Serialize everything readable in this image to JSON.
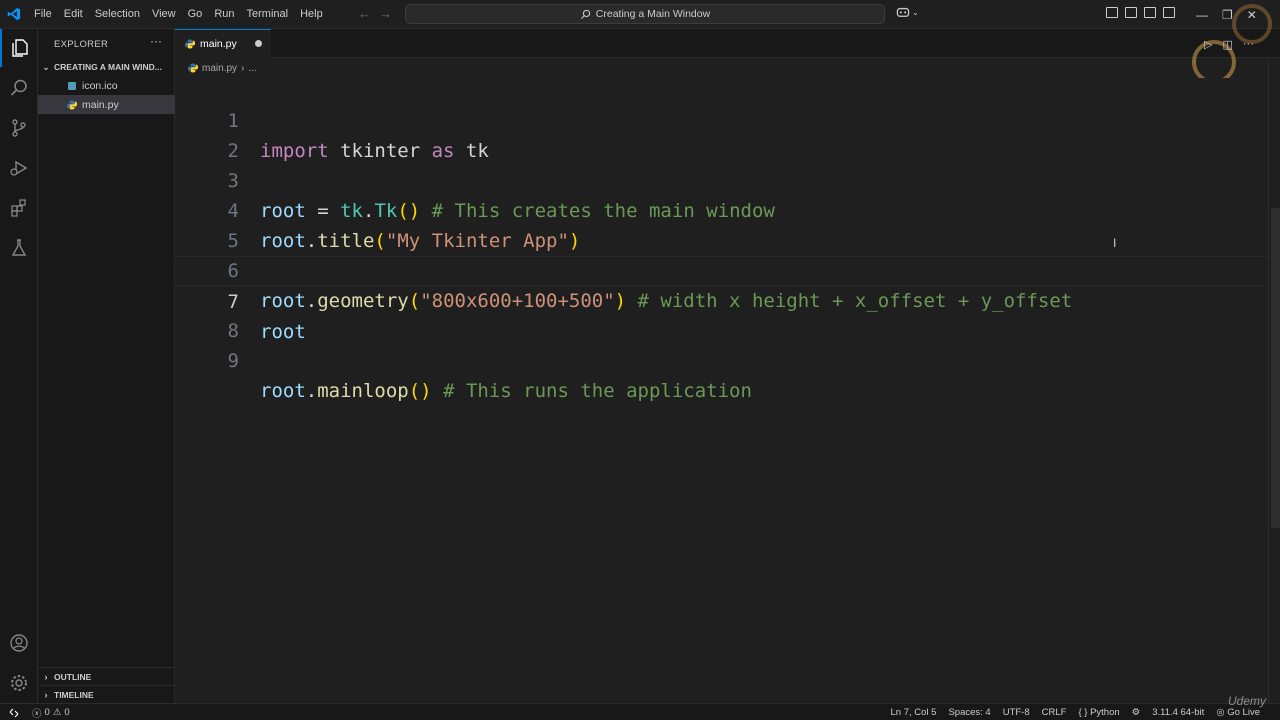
{
  "menu": [
    "File",
    "Edit",
    "Selection",
    "View",
    "Go",
    "Run",
    "Terminal",
    "Help"
  ],
  "command_center": {
    "text": "Creating a Main Window"
  },
  "sidebar": {
    "title": "EXPLORER",
    "folder": "CREATING A MAIN WIND...",
    "files": [
      "icon.ico",
      "main.py"
    ],
    "outline": "OUTLINE",
    "timeline": "TIMELINE"
  },
  "tab": {
    "label": "main.py"
  },
  "breadcrumb": {
    "file": "main.py",
    "more": "..."
  },
  "editor": {
    "line_numbers": [
      "1",
      "2",
      "3",
      "4",
      "5",
      "6",
      "7",
      "8",
      "9"
    ],
    "lines": [
      [
        "import",
        " tkinter ",
        "as",
        " tk"
      ],
      [],
      [
        "root",
        " = ",
        "tk",
        ".",
        "Tk",
        "()",
        " # This creates the main window"
      ],
      [
        "root",
        ".",
        "title",
        "(",
        "\"My Tkinter App\"",
        ")"
      ],
      [],
      [
        "root",
        ".",
        "geometry",
        "(",
        "\"800x600+100+500\"",
        ")",
        " # width x height + x_offset + y_offset"
      ],
      [
        "root"
      ],
      [],
      [
        "root",
        ".",
        "mainloop",
        "()",
        " # This runs the application"
      ]
    ]
  },
  "status": {
    "errors": "0",
    "warnings": "0",
    "position": "Ln 7, Col 5",
    "spaces": "Spaces: 4",
    "encoding": "UTF-8",
    "eol": "CRLF",
    "language": "Python",
    "interpreter": "3.11.4 64-bit",
    "golive": "Go Live"
  },
  "watermark": {
    "udemy": "Udemy"
  },
  "colors": {
    "accent": "#0078d4",
    "keyword": "#c586c0",
    "variable": "#9cdcfe",
    "class": "#4ec9b0",
    "function": "#dcdcaa",
    "string": "#ce9178",
    "comment": "#6a9955",
    "bracket": "#ffd700"
  },
  "icons": [
    "vscode-logo-icon",
    "files-icon",
    "search-icon",
    "source-control-icon",
    "run-debug-icon",
    "extensions-icon",
    "testing-icon",
    "account-icon",
    "manage-gear-icon",
    "python-file-icon",
    "ico-file-icon"
  ]
}
